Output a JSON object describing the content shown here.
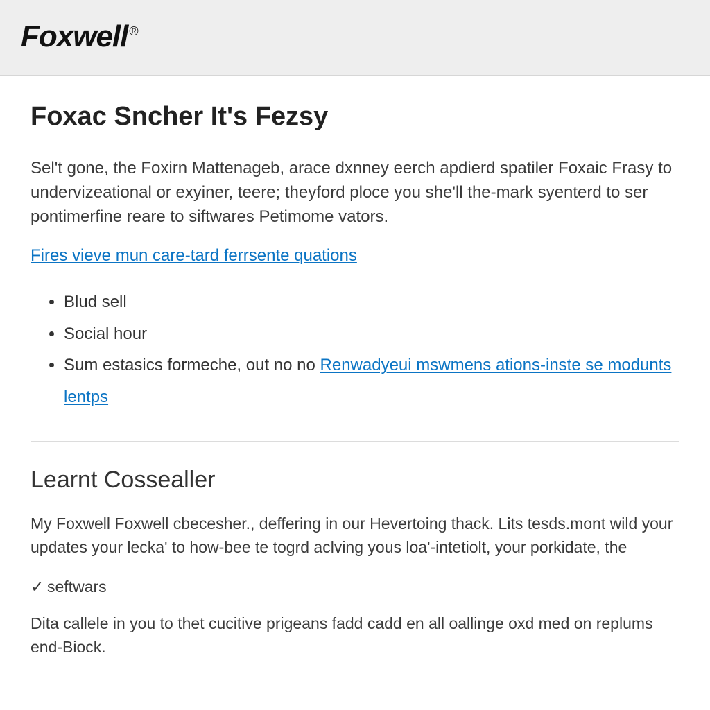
{
  "header": {
    "brand": "Foxwell",
    "brand_mark": "®"
  },
  "main": {
    "title": "Foxac Sncher It's Fezsy",
    "intro": "Sel't gone, the Foxirn Mattenageb, arace dxnney eerch apdierd spatiler Foxaic Frasy to undervizeational or exyiner, teere; theyford ploce you she'll the-mark syenterd to ser pontimerfine reare to siftwares Petimome vators.",
    "link1": "Fires vieve mun care-tard ferrsente quations",
    "bullets": {
      "b1": "Blud sell",
      "b2": "Social hour",
      "b3_prefix": "Sum estasics formeche, out no no ",
      "b3_link": "Renwadyeui mswmens ations-inste se modunts lentps"
    }
  },
  "section2": {
    "heading": "Learnt Cossealler",
    "para1": "My Foxwell Foxwell cbecesher., deffering in our Hevertoing thack. Lits tesds.mont wild your updates your lecka' to how-bee te togrd aclving yous loa'-intetiolt, your porkidate, the",
    "check_label": "seftwars",
    "para2": "Dita callele in you to thet cucitive prigeans fadd cadd en all oallinge oxd med on replums end-Biock."
  }
}
